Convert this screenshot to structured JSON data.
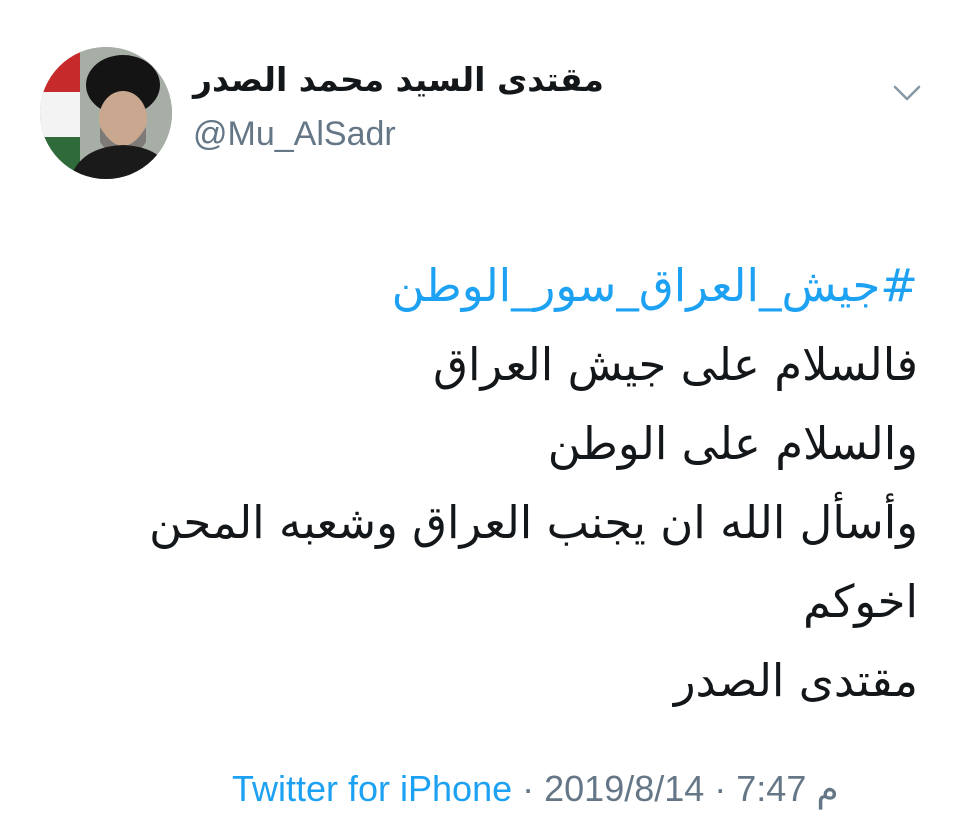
{
  "tweet": {
    "author": {
      "display_name": "مقتدى السيد محمد الصدر",
      "handle": "@Mu_AlSadr",
      "avatar_icon": "profile-photo"
    },
    "menu_icon": "chevron-down-icon",
    "hashtag": "#جيش_العراق_سور_الوطن",
    "lines": [
      "فالسلام على جيش العراق",
      "والسلام على الوطن",
      "وأسأل الله ان يجنب العراق وشعبه المحن",
      "اخوكم",
      "مقتدى الصدر"
    ],
    "source": "Twitter for iPhone",
    "separator": "·",
    "date": "2019/8/14",
    "time": "7:47 م"
  },
  "colors": {
    "link_blue": "#1da1f2",
    "text_dark": "#14171a",
    "text_gray": "#657786"
  }
}
